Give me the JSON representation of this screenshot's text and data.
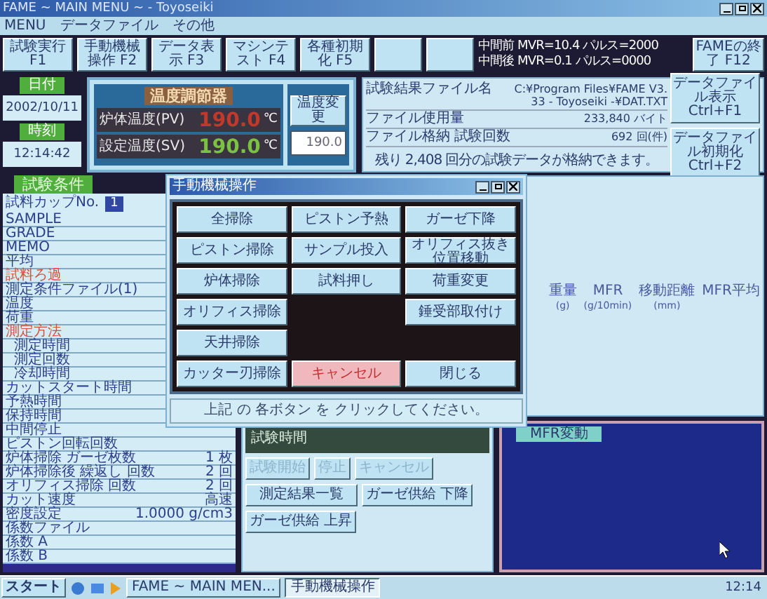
{
  "window": {
    "title": "FAME ~ MAIN MENU ~ - Toyoseiki"
  },
  "menu": [
    "MENU",
    "データファイル",
    "その他"
  ],
  "function_buttons": [
    {
      "kind": "labeled",
      "label": "試験実行 F1"
    },
    {
      "kind": "labeled",
      "label": "手動機械操作 F2"
    },
    {
      "kind": "labeled",
      "label": "データ表示 F3"
    },
    {
      "kind": "labeled",
      "label": "マシンテスト F4"
    },
    {
      "kind": "labeled",
      "label": "各種初期化 F5"
    },
    {
      "kind": "blank"
    },
    {
      "kind": "blank"
    }
  ],
  "pulse_info": [
    "中間前 MVR=10.4 パルス=2000",
    "中間後 MVR=0.1 パルス=0000"
  ],
  "exit_button": "FAMEの終了 F12",
  "date": {
    "label": "日付",
    "value": "2002/10/11"
  },
  "time": {
    "label": "時刻",
    "value": "12:14:42"
  },
  "temperature": {
    "title": "温度調節器",
    "readings": [
      {
        "label": "炉体温度(PV)",
        "value": "190.0",
        "unit": "℃",
        "color": "#c0392b"
      },
      {
        "label": "設定温度(SV)",
        "value": "190.0",
        "unit": "℃",
        "color": "#7cc242"
      }
    ],
    "change_button": "温度変更",
    "setpoint": "190.0"
  },
  "file_info": {
    "rows": [
      {
        "label": "試験結果ファイル名",
        "value": "C:¥Program Files¥FAME V3.33 - Toyoseiki -¥DAT.TXT"
      },
      {
        "label": "ファイル使用量",
        "value": "233,840 バイト"
      },
      {
        "label": "ファイル格納 試験回数",
        "value": "692 回(件)"
      }
    ],
    "note": "残り 2,408 回分の試験データが格納できます。",
    "buttons": [
      "データファイル表示 Ctrl+F1",
      "データファイル初期化 Ctrl+F2"
    ]
  },
  "conditions": {
    "title": "試験条件",
    "cup_label": "試料カップNo.",
    "cup_value": "1",
    "items": [
      {
        "label": "SAMPLE",
        "kind": "item"
      },
      {
        "label": "GRADE",
        "kind": "item"
      },
      {
        "label": "MEMO",
        "kind": "item"
      },
      {
        "label": "平均",
        "kind": "item"
      },
      {
        "label": "試料ろ過",
        "kind": "heading"
      },
      {
        "label": "測定条件ファイル(1)",
        "kind": "item"
      },
      {
        "label": "温度",
        "kind": "item"
      },
      {
        "label": "荷重",
        "kind": "item"
      },
      {
        "label": "測定方法",
        "kind": "heading",
        "children": [
          {
            "label": "測定時間",
            "kind": "item"
          },
          {
            "label": "測定回数",
            "kind": "item"
          },
          {
            "label": "冷却時間",
            "kind": "item"
          }
        ]
      },
      {
        "label": "カットスタート時間",
        "kind": "item"
      },
      {
        "label": "予熱時間",
        "kind": "item"
      },
      {
        "label": "保持時間",
        "kind": "item"
      },
      {
        "label": "中間停止",
        "kind": "item"
      },
      {
        "label": "ピストン回転回数",
        "kind": "item"
      },
      {
        "label": "炉体掃除 ガーゼ枚数",
        "value": "1 枚",
        "kind": "item"
      },
      {
        "label": "炉体掃除後 繰返し 回数",
        "value": "2 回",
        "kind": "item"
      },
      {
        "label": "オリフィス掃除 回数",
        "value": "2 回",
        "kind": "item"
      },
      {
        "label": "カット速度",
        "value": "高速",
        "kind": "item"
      },
      {
        "label": "密度設定",
        "value": "1.0000 g/cm3",
        "kind": "item"
      },
      {
        "label": "係数ファイル",
        "kind": "item"
      },
      {
        "label": "係数 A",
        "kind": "item"
      },
      {
        "label": "係数 B",
        "kind": "item"
      }
    ]
  },
  "results": {
    "columns": [
      {
        "label": "重量",
        "unit": "(g)"
      },
      {
        "label": "MFR",
        "unit": "(g/10min)"
      },
      {
        "label": "移動距離",
        "unit": "(mm)"
      },
      {
        "label": "MFR平均"
      }
    ]
  },
  "test_panel": {
    "title": "試験時間",
    "buttons": [
      {
        "label": "試験開始",
        "disabled": true
      },
      {
        "label": "停止",
        "disabled": true
      },
      {
        "label": "キャンセル",
        "disabled": true
      },
      {
        "label": "測定結果一覧",
        "disabled": false
      },
      {
        "label": "ガーゼ供給 下降",
        "disabled": false
      },
      {
        "label": "ガーゼ供給 上昇",
        "disabled": false
      }
    ]
  },
  "chart": {
    "title": "MFR変動"
  },
  "dialog": {
    "title": "手動機械操作",
    "columns": [
      [
        {
          "label": "全掃除",
          "kind": "normal"
        },
        {
          "label": "ピストン掃除",
          "kind": "normal"
        },
        {
          "label": "炉体掃除",
          "kind": "normal"
        },
        {
          "label": "オリフィス掃除",
          "kind": "normal"
        },
        {
          "label": "天井掃除",
          "kind": "normal"
        },
        {
          "label": "カッター刃掃除",
          "kind": "normal"
        }
      ],
      [
        {
          "label": "ピストン予熱",
          "kind": "normal"
        },
        {
          "label": "サンプル投入",
          "kind": "normal"
        },
        {
          "label": "試料押し",
          "kind": "normal"
        },
        {
          "label": "キャンセル",
          "kind": "cancel"
        }
      ],
      [
        {
          "label": "ガーゼ下降",
          "kind": "normal"
        },
        {
          "label": "オリフィス抜き位置移動",
          "kind": "normal"
        },
        {
          "label": "荷重変更",
          "kind": "normal"
        },
        {
          "label": "錘受部取付け",
          "kind": "normal"
        },
        {
          "label": "閉じる",
          "kind": "normal"
        }
      ]
    ],
    "message": "上記 の 各ボタン を クリックしてください。"
  },
  "taskbar": {
    "start": "スタート",
    "tasks": [
      {
        "label": "FAME ~ MAIN MEN...",
        "selected": false
      },
      {
        "label": "手動機械操作",
        "selected": true
      }
    ],
    "clock": "12:14"
  }
}
